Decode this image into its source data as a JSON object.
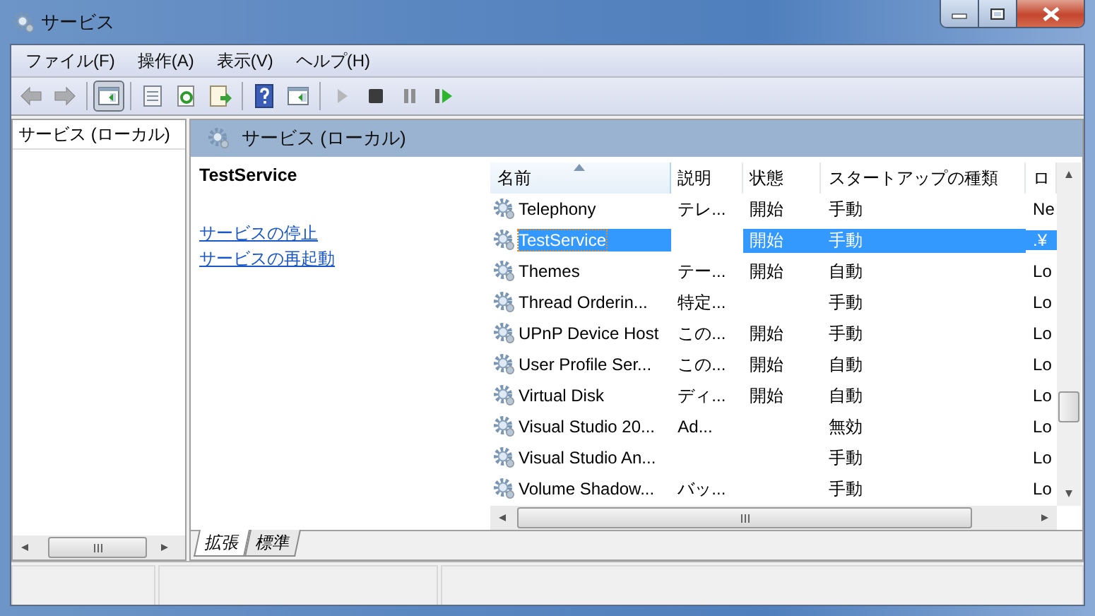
{
  "window": {
    "title": "サービス"
  },
  "menu": [
    {
      "label": "ファイル(F)"
    },
    {
      "label": "操作(A)"
    },
    {
      "label": "表示(V)"
    },
    {
      "label": "ヘルプ(H)"
    }
  ],
  "toolbar": [
    {
      "kind": "back",
      "disabled": true
    },
    {
      "kind": "forward",
      "disabled": true
    },
    {
      "kind": "separator"
    },
    {
      "kind": "console-tree",
      "disabled": false
    },
    {
      "kind": "separator"
    },
    {
      "kind": "properties",
      "disabled": false
    },
    {
      "kind": "refresh",
      "disabled": false
    },
    {
      "kind": "export",
      "disabled": false
    },
    {
      "kind": "separator"
    },
    {
      "kind": "help",
      "disabled": false
    },
    {
      "kind": "action-pane",
      "disabled": false
    },
    {
      "kind": "separator"
    },
    {
      "kind": "start",
      "disabled": true
    },
    {
      "kind": "stop",
      "disabled": false
    },
    {
      "kind": "pause",
      "disabled": false
    },
    {
      "kind": "resume",
      "disabled": false
    }
  ],
  "tree_pane": {
    "header": "サービス (ローカル)"
  },
  "content_header": {
    "title": "サービス (ローカル)"
  },
  "detail": {
    "name": "TestService",
    "links": [
      "サービスの停止",
      "サービスの再起動"
    ]
  },
  "table": {
    "columns": [
      {
        "label": "名前",
        "sorted": true
      },
      {
        "label": "説明",
        "sorted": false
      },
      {
        "label": "状態",
        "sorted": false
      },
      {
        "label": "スタートアップの種類",
        "sorted": false
      },
      {
        "label": "ロ",
        "sorted": false
      }
    ],
    "rows": [
      {
        "cells": [
          "Telephony",
          "テレ...",
          "開始",
          "手動",
          "Ne"
        ],
        "selected": false
      },
      {
        "cells": [
          "TestService",
          "",
          "開始",
          "手動",
          ".¥"
        ],
        "selected": true
      },
      {
        "cells": [
          "Themes",
          "テー...",
          "開始",
          "自動",
          "Lo"
        ],
        "selected": false
      },
      {
        "cells": [
          "Thread Orderin...",
          "特定...",
          "",
          "手動",
          "Lo"
        ],
        "selected": false
      },
      {
        "cells": [
          "UPnP Device Host",
          "この...",
          "開始",
          "手動",
          "Lo"
        ],
        "selected": false
      },
      {
        "cells": [
          "User Profile Ser...",
          "この...",
          "開始",
          "自動",
          "Lo"
        ],
        "selected": false
      },
      {
        "cells": [
          "Virtual Disk",
          "ディ...",
          "開始",
          "自動",
          "Lo"
        ],
        "selected": false
      },
      {
        "cells": [
          "Visual Studio 20...",
          "Ad...",
          "",
          "無効",
          "Lo"
        ],
        "selected": false
      },
      {
        "cells": [
          "Visual Studio An...",
          "",
          "",
          "手動",
          "Lo"
        ],
        "selected": false
      },
      {
        "cells": [
          "Volume Shadow...",
          "バッ...",
          "",
          "手動",
          "Lo"
        ],
        "selected": false
      }
    ]
  },
  "view_tabs": [
    {
      "label": "拡張",
      "selected": true
    },
    {
      "label": "標準",
      "selected": false
    }
  ]
}
